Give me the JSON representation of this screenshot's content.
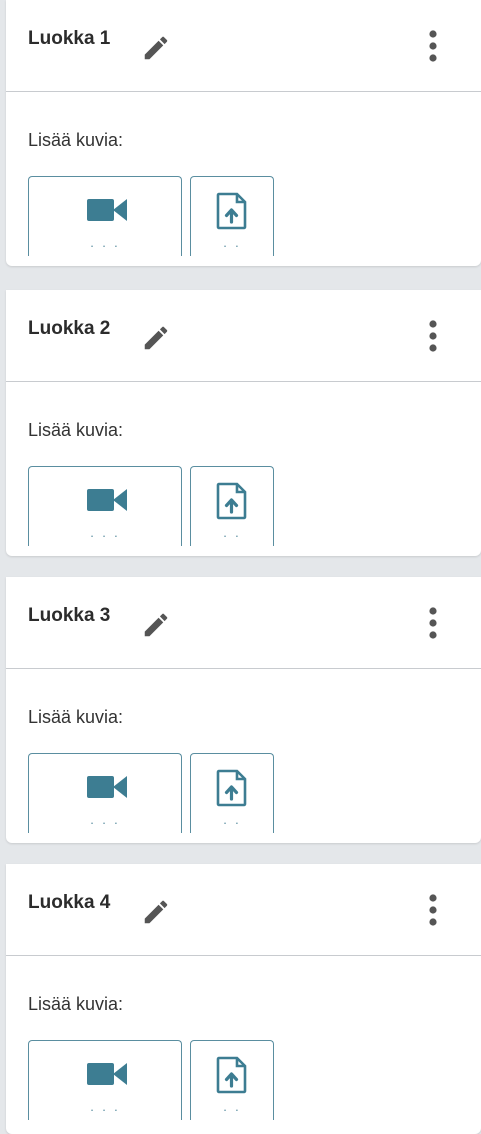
{
  "colors": {
    "background": "#e4e7ea",
    "card": "#ffffff",
    "accent": "#3d7d92",
    "icon_gray": "#555555"
  },
  "icons": {
    "edit": "pencil-icon",
    "menu": "more-vertical-icon",
    "video": "video-camera-icon",
    "upload": "file-upload-icon"
  },
  "cards": [
    {
      "title": "Luokka 1",
      "add_label": "Lisää kuvia:"
    },
    {
      "title": "Luokka 2",
      "add_label": "Lisää kuvia:"
    },
    {
      "title": "Luokka 3",
      "add_label": "Lisää kuvia:"
    },
    {
      "title": "Luokka 4",
      "add_label": "Lisää kuvia:"
    }
  ]
}
